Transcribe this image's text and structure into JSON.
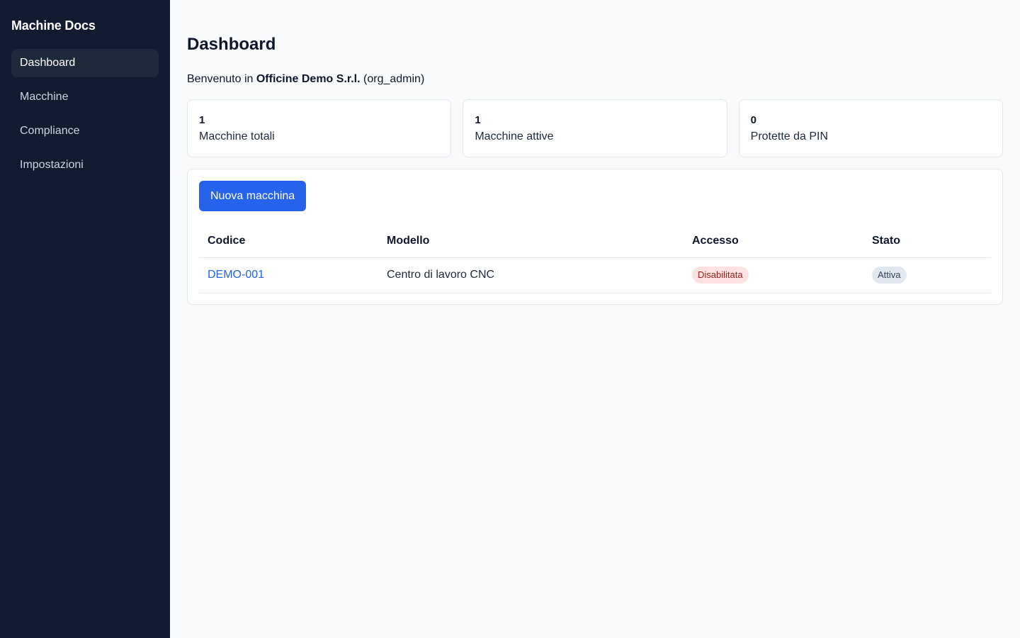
{
  "sidebar": {
    "brand": "Machine Docs",
    "items": [
      {
        "label": "Dashboard"
      },
      {
        "label": "Macchine"
      },
      {
        "label": "Compliance"
      },
      {
        "label": "Impostazioni"
      }
    ]
  },
  "main": {
    "title": "Dashboard",
    "welcome": {
      "prefix": "Benvenuto in",
      "org": "Officine Demo S.r.l.",
      "role": "(org_admin)"
    },
    "stats": [
      {
        "value": "1",
        "label": "Macchine totali"
      },
      {
        "value": "1",
        "label": "Macchine attive"
      },
      {
        "value": "0",
        "label": "Protette da PIN"
      }
    ],
    "new_machine_label": "Nuova macchina",
    "table": {
      "headers": [
        "Codice",
        "Modello",
        "Accesso",
        "Stato"
      ],
      "rows": [
        {
          "code": "DEMO-001",
          "model": "Centro di lavoro CNC",
          "access": "Disabilitata",
          "status": "Attiva"
        }
      ]
    }
  },
  "colors": {
    "sidebar_bg": "#111a2e",
    "accent": "#2563eb",
    "badge_danger_bg": "#fee2e2",
    "badge_neutral_bg": "#e2e8f0"
  }
}
